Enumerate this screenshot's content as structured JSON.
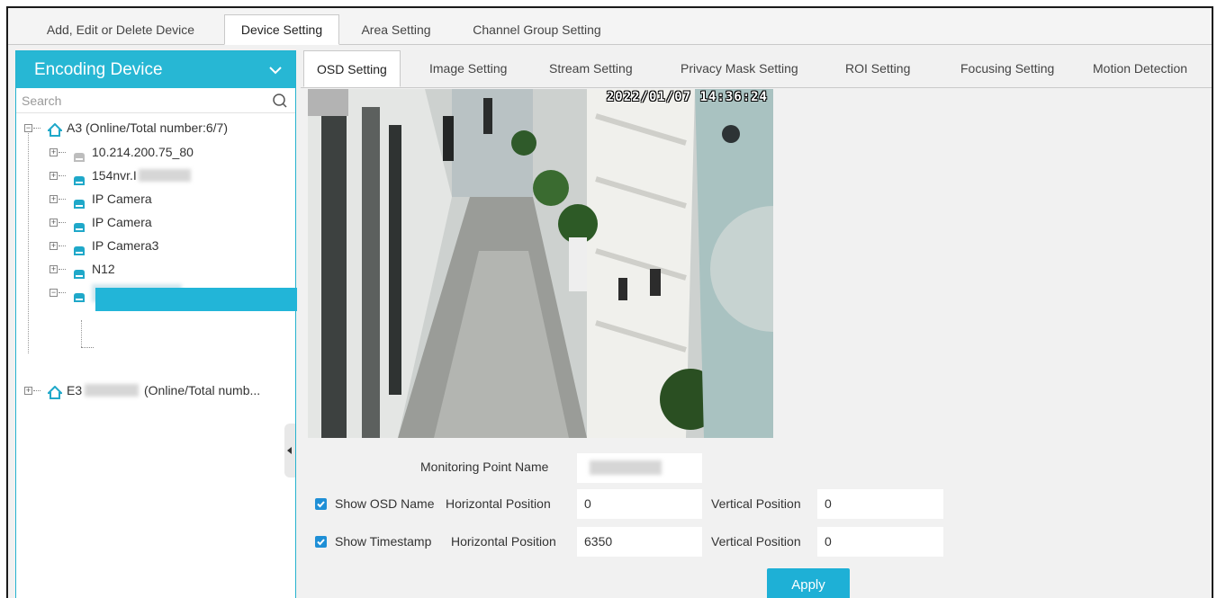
{
  "top_tabs": [
    {
      "label": "Add, Edit or Delete Device"
    },
    {
      "label": "Device Setting"
    },
    {
      "label": "Area Setting"
    },
    {
      "label": "Channel Group Setting"
    }
  ],
  "left_panel": {
    "title": "Encoding Device",
    "search_placeholder": "Search",
    "tree": [
      {
        "label": "A3 (Online/Total number:6/7)"
      },
      {
        "label": "10.214.200.75_80"
      },
      {
        "label": "154nvr.I"
      },
      {
        "label": "IP Camera"
      },
      {
        "label": "IP Camera"
      },
      {
        "label": "IP Camera3"
      },
      {
        "label": "N12"
      },
      {
        "label": ""
      },
      {
        "label": ""
      },
      {
        "label": "E3"
      },
      {
        "label": "(Online/Total numb..."
      }
    ]
  },
  "sub_tabs": [
    {
      "label": "OSD Setting"
    },
    {
      "label": "Image Setting"
    },
    {
      "label": "Stream Setting"
    },
    {
      "label": "Privacy Mask Setting"
    },
    {
      "label": "ROI Setting"
    },
    {
      "label": "Focusing Setting"
    },
    {
      "label": "Motion Detection"
    }
  ],
  "video": {
    "timestamp": "2022/01/07 14:36:24"
  },
  "form": {
    "monitoring_point_label": "Monitoring Point Name",
    "monitoring_point_value": "",
    "show_osd_name": {
      "label": "Show OSD Name",
      "checked": true
    },
    "show_timestamp": {
      "label": "Show Timestamp",
      "checked": true
    },
    "horizontal_label": "Horizontal Position",
    "vertical_label": "Vertical Position",
    "osd_horizontal": "0",
    "osd_vertical": "0",
    "ts_horizontal": "6350",
    "ts_vertical": "0",
    "apply_label": "Apply"
  },
  "colors": {
    "accent": "#27b7d4",
    "checkbox": "#1f8fd6",
    "background": "#f1f1f1"
  }
}
